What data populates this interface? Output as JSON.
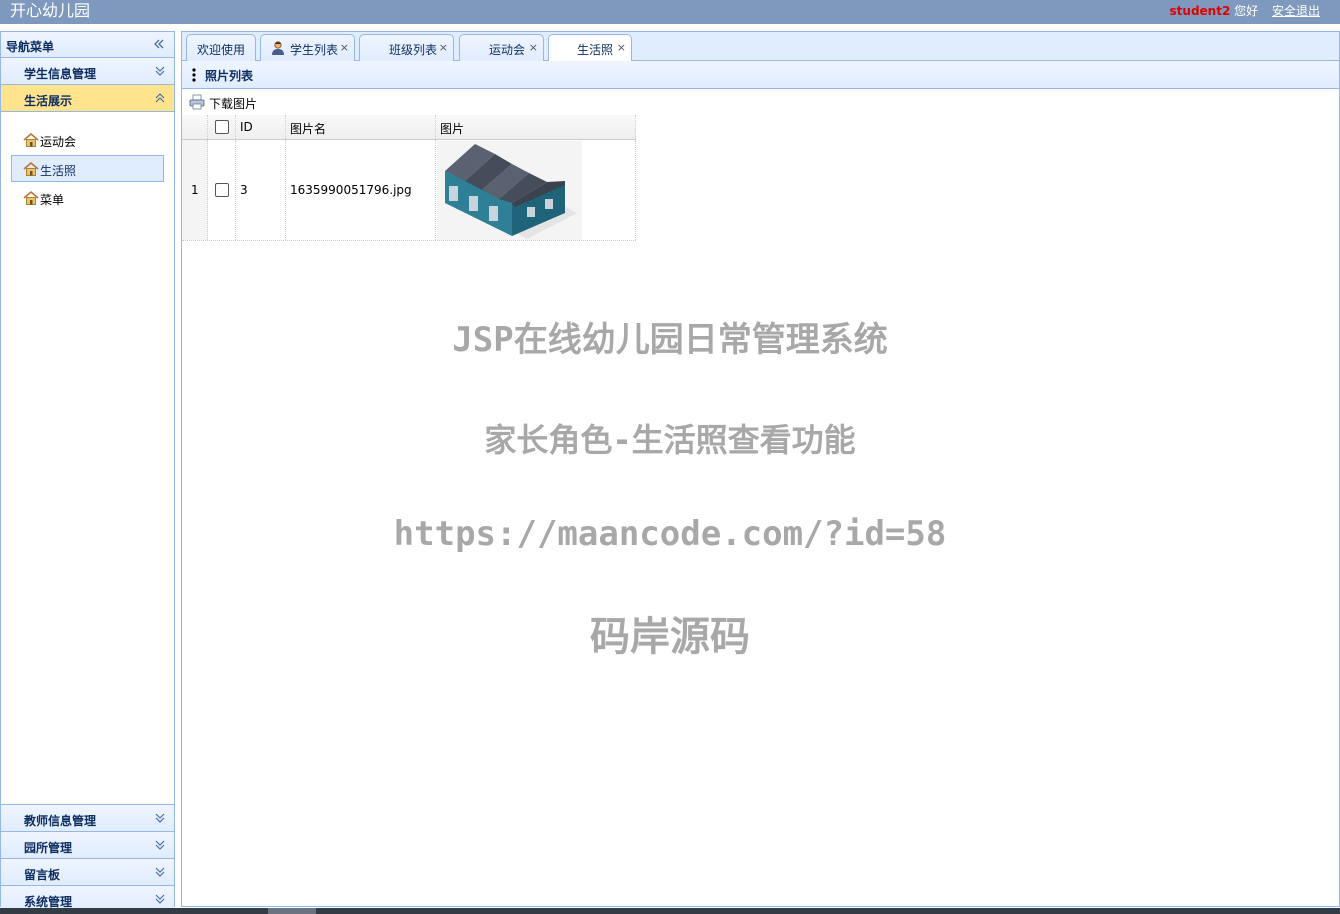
{
  "app": {
    "title": "开心幼儿园"
  },
  "user": {
    "name": "student2",
    "greeting": "您好",
    "logout": "安全退出"
  },
  "nav": {
    "header": "导航菜单",
    "sections": [
      {
        "label": "学生信息管理",
        "expanded": false
      },
      {
        "label": "生活展示",
        "expanded": true
      }
    ],
    "items": [
      {
        "label": "运动会",
        "icon": "house-icon",
        "selected": false
      },
      {
        "label": "生活照",
        "icon": "house-icon",
        "selected": true
      },
      {
        "label": "菜单",
        "icon": "house-icon",
        "selected": false
      }
    ],
    "bottom_sections": [
      {
        "label": "教师信息管理"
      },
      {
        "label": "园所管理"
      },
      {
        "label": "留言板"
      },
      {
        "label": "系统管理"
      }
    ]
  },
  "tabs": [
    {
      "label": "欢迎使用",
      "closable": false,
      "active": false
    },
    {
      "label": "学生列表",
      "closable": true,
      "active": false,
      "icon": "user-icon"
    },
    {
      "label": "班级列表",
      "closable": true,
      "active": false
    },
    {
      "label": "运动会",
      "closable": true,
      "active": false
    },
    {
      "label": "生活照",
      "closable": true,
      "active": true
    }
  ],
  "tab_close_glyph": "×",
  "panel": {
    "title": "照片列表"
  },
  "toolbar": {
    "download_label": "下载图片"
  },
  "grid": {
    "columns": [
      "ID",
      "图片名",
      "图片"
    ],
    "rows": [
      {
        "num": "1",
        "id": "3",
        "name": "1635990051796.jpg",
        "image": "warehouse-building-image"
      }
    ]
  },
  "watermark": {
    "line1": "JSP在线幼儿园日常管理系统",
    "line2": "家长角色-生活照查看功能",
    "line3": "https://maancode.com/?id=58",
    "line4": "码岸源码"
  },
  "colors": {
    "topbar": "#7f99be",
    "panel_border": "#95b8e7",
    "active_section": "#ffe48d",
    "username": "#e00000",
    "watermark": "#a8a8a8"
  }
}
